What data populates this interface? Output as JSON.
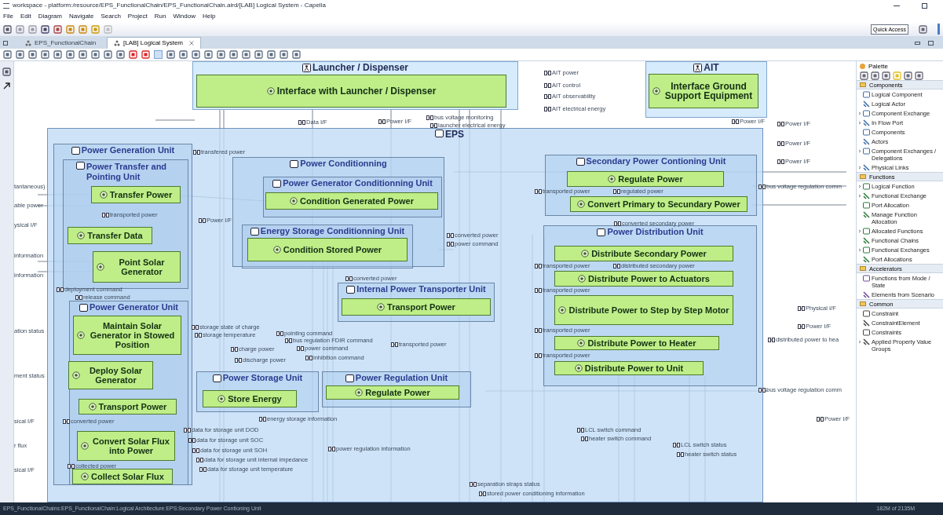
{
  "window": {
    "title": "workspace - platform:/resource/EPS_FunctionalChain/EPS_FunctionalChain.aird/[LAB] Logical System - Capella"
  },
  "menu": [
    "File",
    "Edit",
    "Diagram",
    "Navigate",
    "Search",
    "Project",
    "Run",
    "Window",
    "Help"
  ],
  "quick_access": "Quick Access",
  "tabs": [
    {
      "label": "EPS_FunctionalChain",
      "selected": false
    },
    {
      "label": "[LAB] Logical System",
      "selected": true
    }
  ],
  "diagram": {
    "containers": [
      {
        "label": "Launcher / Dispenser",
        "kind": "actor"
      },
      {
        "label": "AIT",
        "kind": "actor"
      },
      {
        "label": "EPS",
        "kind": "component"
      },
      {
        "label": "Power Generation Unit",
        "kind": "component"
      },
      {
        "label": "Power Transfer and Pointing Unit",
        "kind": "component"
      },
      {
        "label": "Power Conditionning",
        "kind": "component"
      },
      {
        "label": "Power Generator Conditionning Unit",
        "kind": "component"
      },
      {
        "label": "Energy Storage Conditionning Unit",
        "kind": "component"
      },
      {
        "label": "Internal Power Transporter Unit",
        "kind": "component"
      },
      {
        "label": "Power Generator Unit",
        "kind": "component"
      },
      {
        "label": "Power Storage Unit",
        "kind": "component"
      },
      {
        "label": "Power Regulation Unit",
        "kind": "component"
      },
      {
        "label": "Secondary Power Contioning Unit",
        "kind": "component"
      },
      {
        "label": "Power Distribution Unit",
        "kind": "component"
      }
    ],
    "functions": [
      "Interface with Launcher / Dispenser",
      "Interface Ground Support Equipment",
      "Transfer Power",
      "Transfer Data",
      "Point Solar Generator",
      "Condition Generated Power",
      "Condition Stored Power",
      "Transport Power",
      "Regulate Power",
      "Convert Primary to Secundary Power",
      "Distribute Secondary Power",
      "Distribute Power to Actuators",
      "Distribute Power to Step by Step Motor",
      "Distribute Power to Heater",
      "Distribute Power to Unit",
      "Maintain Solar Generator in Stowed Position",
      "Deploy Solar Generator",
      "Transport Power",
      "Store Energy",
      "Regulate Power",
      "Convert Solar Flux into Power",
      "Collect Solar Flux"
    ],
    "exchanges": [
      "AIT power",
      "AIT control",
      "AIT observability",
      "AIT electrical energy",
      "Data I/F",
      "Power I/F",
      "bus voltage monitoring",
      "launcher electrical energy",
      "Power I/F",
      "Power I/F",
      "Power I/F",
      "Power I/F",
      "bus voltage regulation comm",
      "transfered power",
      "transported power",
      "Power I/F",
      "converted power",
      "power command",
      "converted power",
      "transported power",
      "regulated power",
      "converted secondary power",
      "transported power",
      "distributed secondary power",
      "transported power",
      "transported power",
      "transported power",
      "Physical I/F",
      "Power I/F",
      "distributed power to hea",
      "bus voltage regulation comm",
      "Power I/F",
      "deployment command",
      "release command",
      "storage state of charge",
      "storage temperature",
      "charge power",
      "discharge power",
      "pointing command",
      "bus regulation FDIR command",
      "power command",
      "inhibition command",
      "transported power",
      "converted power",
      "energy storage information",
      "data for storage unit DOD",
      "data for storage unit SOC",
      "data for storage unit SOH",
      "data for storage unit internal impedance",
      "data for storage unit temperature",
      "power regulation information",
      "LCL switch command",
      "heater switch command",
      "LCL switch status",
      "heater switch status",
      "collected power",
      "separation straps status",
      "stored power conditioning information"
    ],
    "edge_labels": [
      "tantaneous)",
      "able power",
      "ysical I/F",
      "information",
      "information",
      "ation status",
      "ment status",
      "sical I/F",
      "r flux",
      "sical I/F"
    ]
  },
  "palette": {
    "title": "Palette",
    "sections": [
      {
        "title": "Components",
        "items": [
          {
            "label": "Logical Component",
            "expandable": false
          },
          {
            "label": "Logical Actor",
            "expandable": false
          },
          {
            "label": "Component Exchange",
            "expandable": true
          },
          {
            "label": "In Flow Port",
            "expandable": true
          },
          {
            "label": "Components",
            "expandable": false
          },
          {
            "label": "Actors",
            "expandable": false
          },
          {
            "label": "Component Exchanges / Delegations",
            "expandable": true
          },
          {
            "label": "Physical Links",
            "expandable": true
          }
        ]
      },
      {
        "title": "Functions",
        "items": [
          {
            "label": "Logical Function",
            "expandable": true
          },
          {
            "label": "Functional Exchange",
            "expandable": true
          },
          {
            "label": "Port Allocation",
            "expandable": false
          },
          {
            "label": "Manage Function Allocation",
            "expandable": false
          },
          {
            "label": "Allocated Functions",
            "expandable": true
          },
          {
            "label": "Functional Chains",
            "expandable": false
          },
          {
            "label": "Functional Exchanges",
            "expandable": true
          },
          {
            "label": "Port Allocations",
            "expandable": false
          }
        ]
      },
      {
        "title": "Accelerators",
        "items": [
          {
            "label": "Functions from Mode / State",
            "expandable": false
          },
          {
            "label": "Elements from Scenario",
            "expandable": false
          }
        ]
      },
      {
        "title": "Common",
        "items": [
          {
            "label": "Constraint",
            "expandable": false
          },
          {
            "label": "ConstraintElement",
            "expandable": false
          },
          {
            "label": "Constraints",
            "expandable": false
          },
          {
            "label": "Applied Property Value Groups",
            "expandable": true
          }
        ]
      }
    ]
  },
  "status_bar": {
    "path": "EPS_FunctionalChains:EPS_FunctionalChain:Logical Architecture:EPS:Secondary Power Contioning Unit",
    "memory": "182M of 2135M"
  }
}
